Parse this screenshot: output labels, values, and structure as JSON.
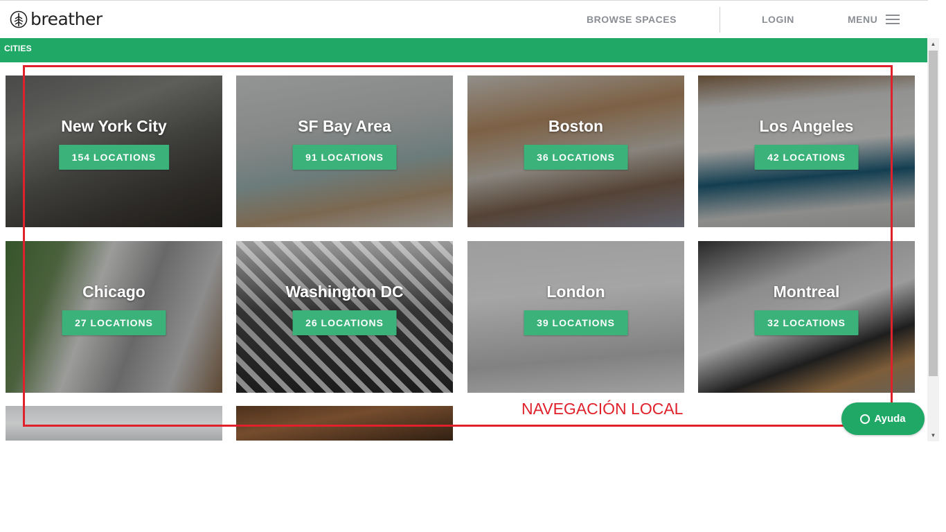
{
  "header": {
    "logo_text": "breather",
    "nav": {
      "browse_label": "BROWSE SPACES",
      "login_label": "LOGIN",
      "menu_label": "MENU"
    }
  },
  "section": {
    "label": "CITIES"
  },
  "cities": [
    {
      "name": "New York City",
      "locations": "154 LOCATIONS"
    },
    {
      "name": "SF Bay Area",
      "locations": "91 LOCATIONS"
    },
    {
      "name": "Boston",
      "locations": "36 LOCATIONS"
    },
    {
      "name": "Los Angeles",
      "locations": "42 LOCATIONS"
    },
    {
      "name": "Chicago",
      "locations": "27 LOCATIONS"
    },
    {
      "name": "Washington DC",
      "locations": "26 LOCATIONS"
    },
    {
      "name": "London",
      "locations": "39 LOCATIONS"
    },
    {
      "name": "Montreal",
      "locations": "32 LOCATIONS"
    }
  ],
  "annotation": {
    "label": "NAVEGACIÓN LOCAL"
  },
  "help": {
    "label": "Ayuda"
  },
  "colors": {
    "brand_green": "#20a866",
    "button_green": "#3ab27a",
    "annotation_red": "#e0202a"
  }
}
